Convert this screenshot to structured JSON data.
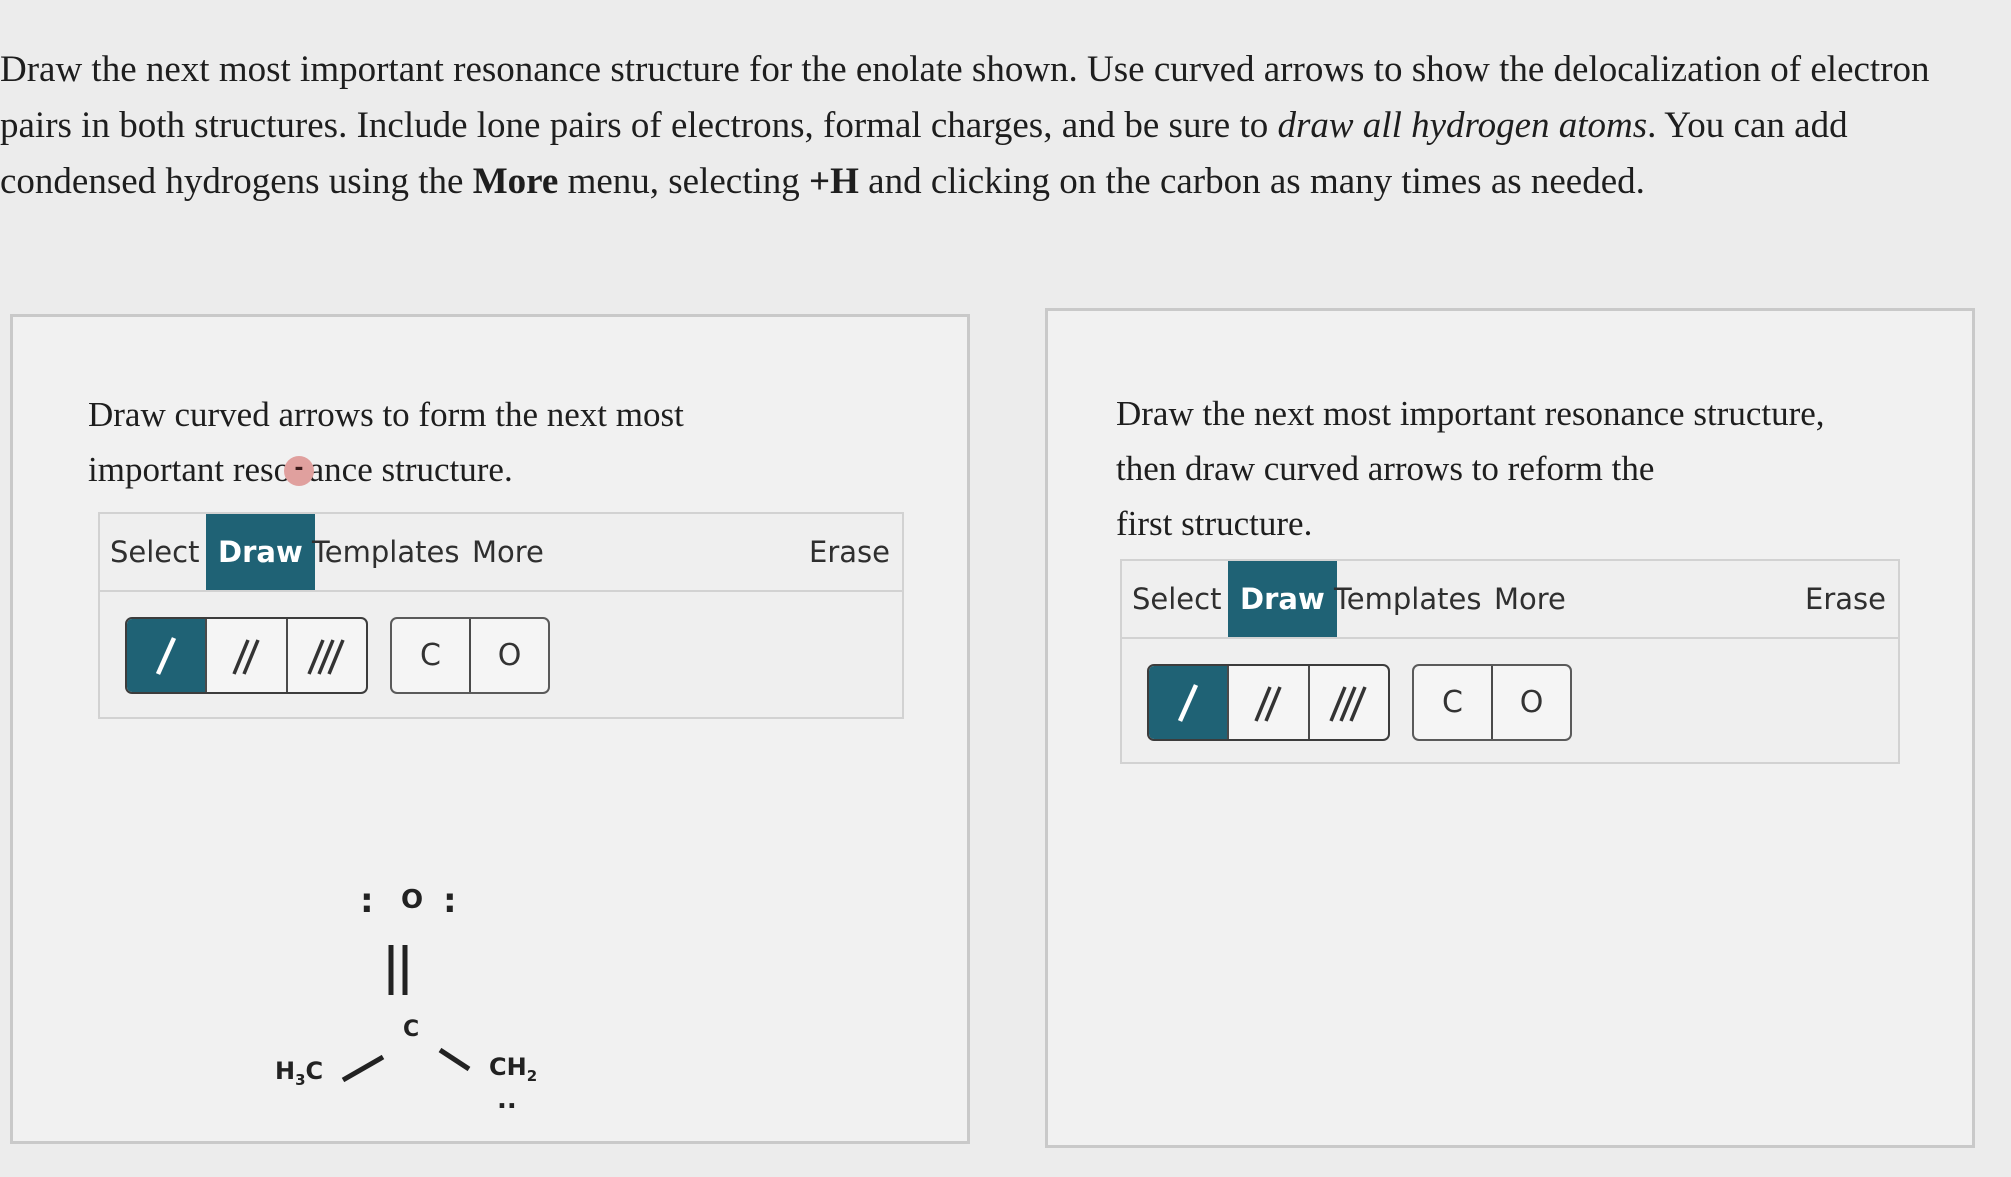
{
  "instructions": {
    "part1": "Draw the next most important resonance structure for the enolate shown. Use curved arrows to show the delocalization of electron pairs in both structures. Include lone pairs of electrons, formal charges, and be sure to ",
    "emphasis": "draw all hydrogen atoms",
    "part2": ". You can add condensed hydrogens using the ",
    "bold_more": "More",
    "part3": " menu, selecting ",
    "bold_h": "+H",
    "part4": " and clicking on the carbon as many times as needed."
  },
  "left_panel": {
    "prompt_line1": "Draw curved arrows to form the next most",
    "prompt_line2": "important resonance structure.",
    "menu": {
      "select": "Select",
      "draw": "Draw",
      "templates": "Templates",
      "more": "More",
      "erase": "Erase"
    },
    "bond_tools": [
      "/",
      "//",
      "///"
    ],
    "atom_tools": [
      "C",
      "O"
    ],
    "molecule": {
      "oxygen": "O",
      "carbonyl_carbon": "C",
      "methyl": "H",
      "methyl_sub": "3",
      "methyl_c": "C",
      "methylene": "CH",
      "methylene_sub": "2",
      "charge": "-",
      "lone_pair_left": ":",
      "lone_pair_right": ":",
      "lone_pair_bottom": ".."
    }
  },
  "right_panel": {
    "prompt_line1": "Draw the next most important resonance structure,",
    "prompt_line2": "then draw curved arrows to reform the",
    "prompt_line3": "first structure.",
    "menu": {
      "select": "Select",
      "draw": "Draw",
      "templates": "Templates",
      "more": "More",
      "erase": "Erase"
    },
    "bond_tools": [
      "/",
      "//",
      "///"
    ],
    "atom_tools": [
      "C",
      "O"
    ]
  },
  "colors": {
    "accent": "#1f6275",
    "charge_badge": "#e0a09e",
    "background": "#ececec"
  },
  "icons": {
    "single_bond": "single-bond-icon",
    "double_bond": "double-bond-icon",
    "triple_bond": "triple-bond-icon"
  }
}
